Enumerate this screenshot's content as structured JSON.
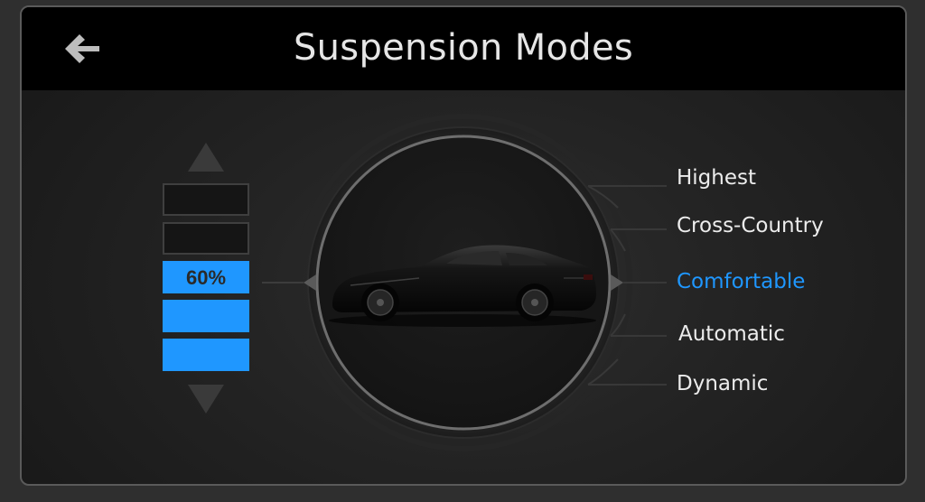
{
  "header": {
    "title": "Suspension Modes",
    "back_icon": "arrow-left-icon"
  },
  "height_control": {
    "up_icon": "triangle-up-icon",
    "down_icon": "triangle-down-icon",
    "level_label": "60%",
    "segments_total": 5,
    "segments_filled": 3,
    "active_color": "#1f97ff"
  },
  "vehicle": {
    "icon": "sports-car-icon",
    "color": "#0e0e0e"
  },
  "modes": [
    {
      "label": "Highest",
      "active": false
    },
    {
      "label": "Cross-Country",
      "active": false
    },
    {
      "label": "Comfortable",
      "active": true
    },
    {
      "label": "Automatic",
      "active": false
    },
    {
      "label": "Dynamic",
      "active": false
    }
  ],
  "colors": {
    "accent": "#1f97ff",
    "text": "#ececec",
    "header_bg": "#000000"
  }
}
